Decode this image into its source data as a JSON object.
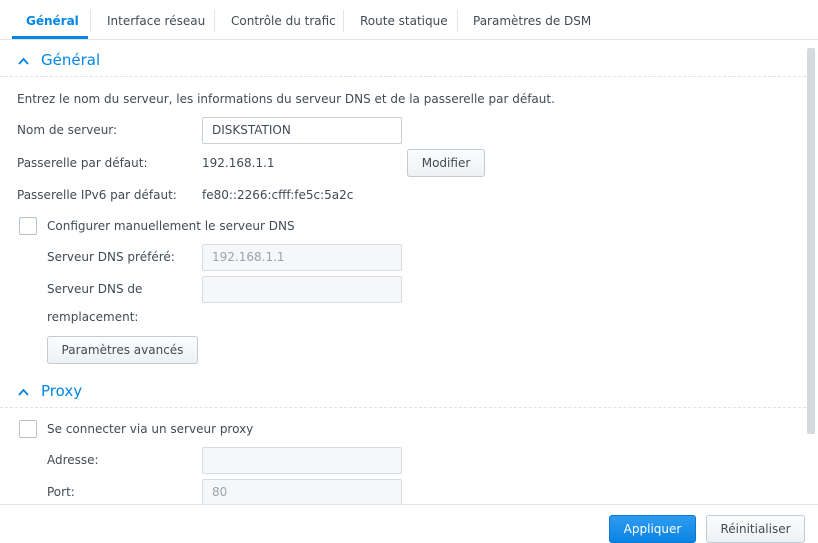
{
  "tabs": [
    {
      "label": "Général",
      "active": true
    },
    {
      "label": "Interface réseau"
    },
    {
      "label": "Contrôle du trafic"
    },
    {
      "label": "Route statique"
    },
    {
      "label": "Paramètres de DSM"
    }
  ],
  "general": {
    "title": "Général",
    "description": "Entrez le nom du serveur, les informations du serveur DNS et de la passerelle par défaut.",
    "server_name_label": "Nom de serveur:",
    "server_name_value": "DISKSTATION",
    "gateway_label": "Passerelle par défaut:",
    "gateway_value": "192.168.1.1",
    "modify_label": "Modifier",
    "ipv6_gateway_label": "Passerelle IPv6 par défaut:",
    "ipv6_gateway_value": "fe80::2266:cfff:fe5c:5a2c",
    "manual_dns_label": "Configurer manuellement le serveur DNS",
    "manual_dns_checked": false,
    "preferred_dns_label": "Serveur DNS préféré:",
    "preferred_dns_value": "192.168.1.1",
    "alternate_dns_label_line1": "Serveur DNS de",
    "alternate_dns_label_line2": "remplacement:",
    "alternate_dns_value": "",
    "advanced_label": "Paramètres avancés"
  },
  "proxy": {
    "title": "Proxy",
    "connect_label": "Se connecter via un serveur proxy",
    "connect_checked": false,
    "address_label": "Adresse:",
    "address_value": "",
    "port_label": "Port:",
    "port_value": "80"
  },
  "footer": {
    "apply_label": "Appliquer",
    "reset_label": "Réinitialiser"
  },
  "colors": {
    "accent": "#0086e5",
    "text": "#414b55"
  }
}
